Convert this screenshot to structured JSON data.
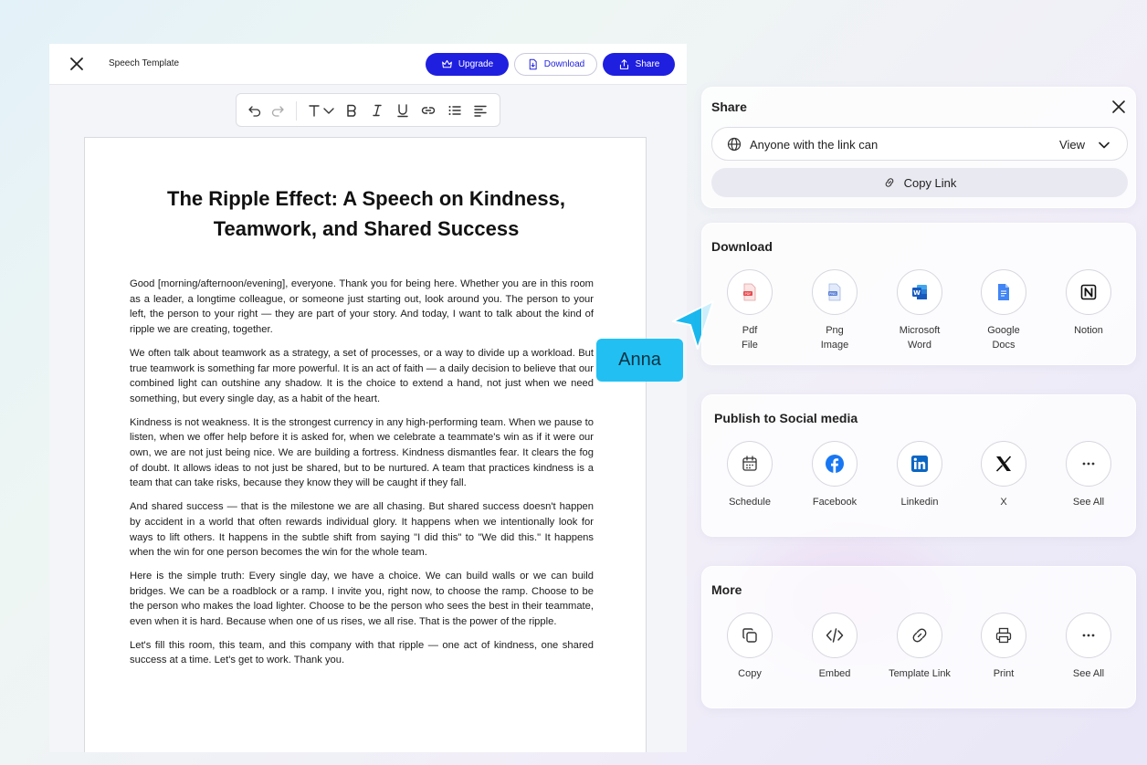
{
  "editor": {
    "doc_name": "Speech Template",
    "upgrade_label": "Upgrade",
    "download_label": "Download",
    "share_label": "Share"
  },
  "document": {
    "title_line1": "The Ripple Effect: A Speech on Kindness,",
    "title_line2": "Teamwork, and Shared Success",
    "paragraphs": [
      "Good [morning/afternoon/evening], everyone. Thank you for being here. Whether you are in this room as a leader, a longtime colleague, or someone just starting out, look around you. The person to your left, the person to your right — they are part of your story. And today, I want to talk about the kind of ripple we are creating, together.",
      "We often talk about teamwork as a strategy, a set of processes, or a way to divide up a workload. But true teamwork is something far more powerful. It is an act of faith — a daily decision to believe that our combined light can outshine any shadow. It is the choice to extend a hand, not just when we need something, but every single day, as a habit of the heart.",
      "Kindness is not weakness. It is the strongest currency in any high-performing team. When we pause to listen, when we offer help before it is asked for, when we celebrate a teammate's win as if it were our own, we are not just being nice. We are building a fortress. Kindness dismantles fear. It clears the fog of doubt. It allows ideas to not just be shared, but to be nurtured. A team that practices kindness is a team that can take risks, because they know they will be caught if they fall.",
      "And shared success — that is the milestone we are all chasing. But shared success doesn't happen by accident in a world that often rewards individual glory. It happens when we intentionally look for ways to lift others. It happens in the subtle shift from saying \"I did this\" to \"We did this.\" It happens when the win for one person becomes the win for the whole team.",
      "Here is the simple truth: Every single day, we have a choice. We can build walls or we can build bridges. We can be a roadblock or a ramp. I invite you, right now, to choose the ramp. Choose to be the person who makes the load lighter. Choose to be the person who sees the best in their teammate, even when it is hard. Because when one of us rises, we all rise. That is the power of the ripple.",
      "Let's fill this room, this team, and this company with that ripple — one act of kindness, one shared success at a time. Let's get to work. Thank you."
    ]
  },
  "collaborator": {
    "name": "Anna",
    "color": "#22c0f2"
  },
  "share_panel": {
    "title": "Share",
    "access_label": "Anyone with the link can",
    "access_value": "View",
    "copy_link_label": "Copy Link"
  },
  "download_panel": {
    "title": "Download",
    "options": [
      {
        "line1": "Pdf",
        "line2": "File",
        "icon": "pdf-file-icon"
      },
      {
        "line1": "Png",
        "line2": "Image",
        "icon": "png-image-icon"
      },
      {
        "line1": "Microsoft",
        "line2": "Word",
        "icon": "word-icon"
      },
      {
        "line1": "Google",
        "line2": "Docs",
        "icon": "google-docs-icon"
      },
      {
        "line1": "Notion",
        "line2": "",
        "icon": "notion-icon"
      }
    ]
  },
  "social_panel": {
    "title": "Publish to Social media",
    "options": [
      {
        "label": "Schedule",
        "icon": "calendar-icon"
      },
      {
        "label": "Facebook",
        "icon": "facebook-icon"
      },
      {
        "label": "Linkedin",
        "icon": "linkedin-icon"
      },
      {
        "label": "X",
        "icon": "x-icon"
      },
      {
        "label": "See All",
        "icon": "more-dots-icon"
      }
    ]
  },
  "more_panel": {
    "title": "More",
    "options": [
      {
        "label": "Copy",
        "icon": "copy-icon"
      },
      {
        "label": "Embed",
        "icon": "embed-code-icon"
      },
      {
        "label": "Template Link",
        "icon": "link-icon"
      },
      {
        "label": "Print",
        "icon": "printer-icon"
      },
      {
        "label": "See All",
        "icon": "more-dots-icon"
      }
    ]
  },
  "colors": {
    "accent": "#1f1fe0",
    "facebook": "#1877f2",
    "linkedin": "#0a66c2",
    "word": "#185abd",
    "google_docs": "#4285f4",
    "pdf": "#e5484d"
  }
}
